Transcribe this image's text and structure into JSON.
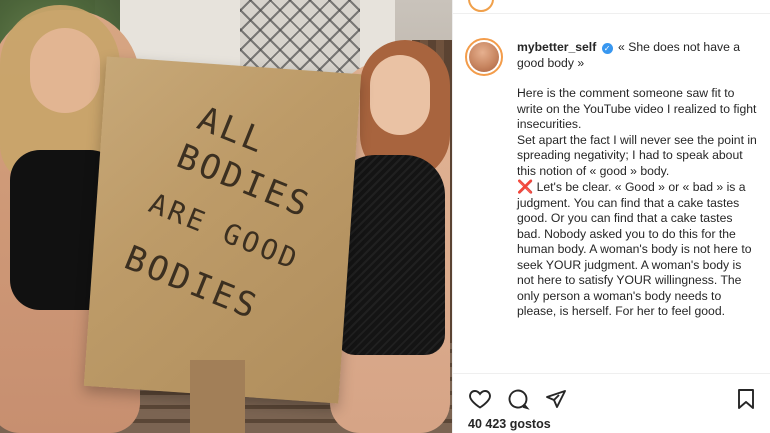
{
  "post": {
    "sign_text": [
      "ALL",
      "BODIES",
      "ARE GOOD",
      "BODIES"
    ]
  },
  "caption": {
    "username": "mybetter_self",
    "headline": "« She does not have a good body »",
    "para1": "Here is the comment someone saw fit to write on the YouTube video I realized to fight insecurities.",
    "para2": "Set apart the fact I will never see the point in spreading negativity; I had to speak about this notion of « good » body.",
    "para3_icon": "❌",
    "para3": "Let's be clear. « Good » or « bad » is a judgment. You can find that a cake tastes good. Or you can find that a cake tastes bad. Nobody asked you to do this for the human body. A woman's body is not here to seek YOUR judgment. A woman's body is not here to satisfy YOUR willingness. The only person a woman's body needs to please, is herself. For her to feel good."
  },
  "actions": {
    "like_icon": "heart-icon",
    "comment_icon": "comment-icon",
    "share_icon": "share-icon",
    "save_icon": "bookmark-icon"
  },
  "likes_text": "40 423 gostos",
  "colors": {
    "verified": "#3897f0",
    "avatar_ring": "#f39c4a",
    "text": "#262626"
  }
}
